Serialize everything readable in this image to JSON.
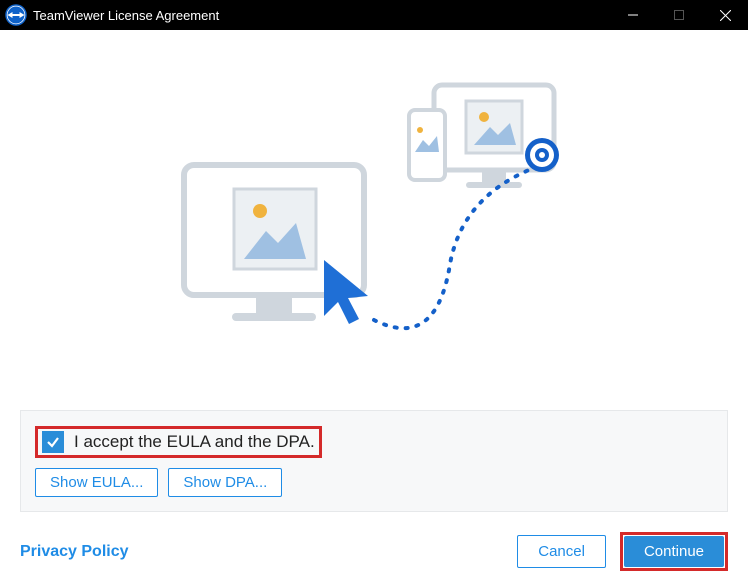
{
  "window": {
    "title": "TeamViewer License Agreement"
  },
  "accept": {
    "checkbox_checked": true,
    "label": "I accept the EULA and the DPA.",
    "show_eula": "Show EULA...",
    "show_dpa": "Show DPA..."
  },
  "footer": {
    "privacy": "Privacy Policy",
    "cancel": "Cancel",
    "continue": "Continue"
  },
  "highlights": {
    "checkbox_row": true,
    "continue_button": true
  },
  "colors": {
    "accent": "#2a8dd8",
    "highlight_border": "#d42a2a"
  }
}
